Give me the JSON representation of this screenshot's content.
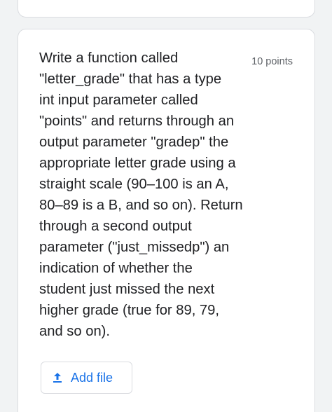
{
  "question": {
    "text": "Write a function called\n\"letter_grade\" that has a type\nint input parameter called\n\"points\" and returns through an\noutput parameter \"gradep\" the\nappropriate letter grade using a\nstraight scale (90–100 is an A,\n80–89 is a B, and so on). Return\nthrough a second output\nparameter (\"just_missedp\") an\nindication of whether the\nstudent just missed the next\nhigher grade (true for 89, 79,\nand so on).",
    "points": "10 points"
  },
  "upload": {
    "label": "Add file",
    "icon": "upload-icon"
  },
  "colors": {
    "page_background": "#f1f3f4",
    "card_background": "#ffffff",
    "border": "#dadce0",
    "accent": "#1a73e8",
    "text": "#202124",
    "secondary_text": "#5f6368"
  }
}
